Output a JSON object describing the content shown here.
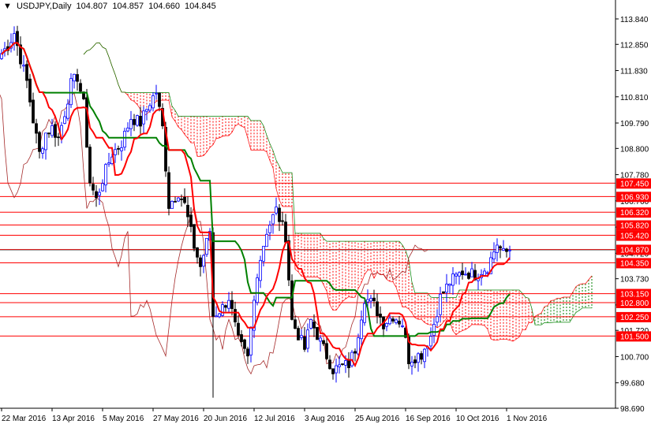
{
  "header": {
    "symbol": "USDJPY,Daily",
    "open": "104.807",
    "high": "104.857",
    "low": "104.660",
    "close": "104.845"
  },
  "chart_data": {
    "type": "candlestick",
    "title": "USDJPY,Daily",
    "ylim": [
      98.69,
      113.84
    ],
    "y_ticks": [
      "113.840",
      "112.850",
      "111.830",
      "110.810",
      "109.790",
      "108.800",
      "107.780",
      "106.760",
      "105.740",
      "104.720",
      "103.730",
      "102.710",
      "101.720",
      "100.700",
      "99.680",
      "98.690"
    ],
    "x_ticks": [
      {
        "label": "22 Mar 2016",
        "bar": 0
      },
      {
        "label": "13 Apr 2016",
        "bar": 16
      },
      {
        "label": "5 May 2016",
        "bar": 32
      },
      {
        "label": "27 May 2016",
        "bar": 48
      },
      {
        "label": "20 Jun 2016",
        "bar": 64
      },
      {
        "label": "12 Jul 2016",
        "bar": 80
      },
      {
        "label": "3 Aug 2016",
        "bar": 96
      },
      {
        "label": "25 Aug 2016",
        "bar": 112
      },
      {
        "label": "16 Sep 2016",
        "bar": 128
      },
      {
        "label": "10 Oct 2016",
        "bar": 144
      },
      {
        "label": "1 Nov 2016",
        "bar": 160
      }
    ],
    "close_anchors": [
      [
        0,
        112.5
      ],
      [
        2,
        112.8
      ],
      [
        4,
        113.3
      ],
      [
        6,
        112.3
      ],
      [
        8,
        111.4
      ],
      [
        10,
        109.9
      ],
      [
        12,
        108.6
      ],
      [
        14,
        109.4
      ],
      [
        16,
        109.6
      ],
      [
        18,
        109.2
      ],
      [
        20,
        110.2
      ],
      [
        22,
        111.3
      ],
      [
        24,
        111.6
      ],
      [
        26,
        110.5
      ],
      [
        28,
        107.5
      ],
      [
        30,
        106.8
      ],
      [
        32,
        107.6
      ],
      [
        35,
        108.6
      ],
      [
        38,
        109.0
      ],
      [
        41,
        110.0
      ],
      [
        44,
        109.8
      ],
      [
        47,
        110.6
      ],
      [
        49,
        111.0
      ],
      [
        51,
        109.6
      ],
      [
        53,
        106.6
      ],
      [
        56,
        107.1
      ],
      [
        58,
        106.6
      ],
      [
        61,
        105.0
      ],
      [
        63,
        104.2
      ],
      [
        66,
        105.6
      ],
      [
        67,
        102.3
      ],
      [
        70,
        102.6
      ],
      [
        72,
        103.0
      ],
      [
        75,
        101.3
      ],
      [
        78,
        100.6
      ],
      [
        81,
        104.0
      ],
      [
        84,
        105.6
      ],
      [
        87,
        106.4
      ],
      [
        90,
        105.4
      ],
      [
        92,
        102.1
      ],
      [
        96,
        101.0
      ],
      [
        98,
        102.1
      ],
      [
        102,
        101.0
      ],
      [
        105,
        100.2
      ],
      [
        110,
        100.4
      ],
      [
        112,
        101.0
      ],
      [
        115,
        103.0
      ],
      [
        118,
        102.7
      ],
      [
        121,
        102.0
      ],
      [
        124,
        102.3
      ],
      [
        127,
        102.0
      ],
      [
        129,
        100.6
      ],
      [
        133,
        100.8
      ],
      [
        136,
        101.5
      ],
      [
        139,
        103.0
      ],
      [
        142,
        103.6
      ],
      [
        146,
        104.0
      ],
      [
        150,
        103.9
      ],
      [
        154,
        104.2
      ],
      [
        157,
        105.1
      ],
      [
        159,
        104.7
      ],
      [
        161,
        104.845
      ]
    ],
    "brexit_low": {
      "bar": 67,
      "price": 99.1
    },
    "levels": [
      {
        "label": "107.450",
        "value": 107.45
      },
      {
        "label": "106.930",
        "value": 106.93
      },
      {
        "label": "106.320",
        "value": 106.32
      },
      {
        "label": "105.820",
        "value": 105.82
      },
      {
        "label": "105.420",
        "value": 105.42
      },
      {
        "label": "104.870",
        "value": 104.87
      },
      {
        "label": "104.350",
        "value": 104.35
      },
      {
        "label": "103.150",
        "value": 103.15
      },
      {
        "label": "102.800",
        "value": 102.8
      },
      {
        "label": "102.250",
        "value": 102.25
      },
      {
        "label": "101.500",
        "value": 101.5
      }
    ],
    "current_price": 104.845,
    "colors": {
      "level": "#ff0000",
      "tenkan": "#ff0000",
      "kijun": "#008000",
      "chikou": "#a52a2a",
      "bull": "#0000ff",
      "bear": "#000000"
    }
  }
}
